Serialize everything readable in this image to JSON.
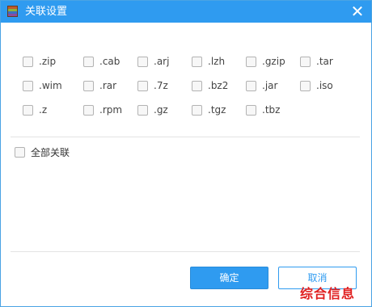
{
  "window": {
    "title": "关联设置",
    "close_symbol": "✕"
  },
  "extensions": [
    [
      ".zip",
      ".cab",
      ".arj",
      ".lzh",
      ".gzip",
      ".tar"
    ],
    [
      ".wim",
      ".rar",
      ".7z",
      ".bz2",
      ".jar",
      ".iso"
    ],
    [
      ".z",
      ".rpm",
      ".gz",
      ".tgz",
      ".tbz"
    ]
  ],
  "select_all_label": "全部关联",
  "buttons": {
    "ok_label": "确定",
    "cancel_label": "取消"
  },
  "watermark": "综合信息",
  "colors": {
    "titlebar": "#2f9bf0",
    "primary_button": "#2f9bf0",
    "watermark": "#e02020"
  }
}
